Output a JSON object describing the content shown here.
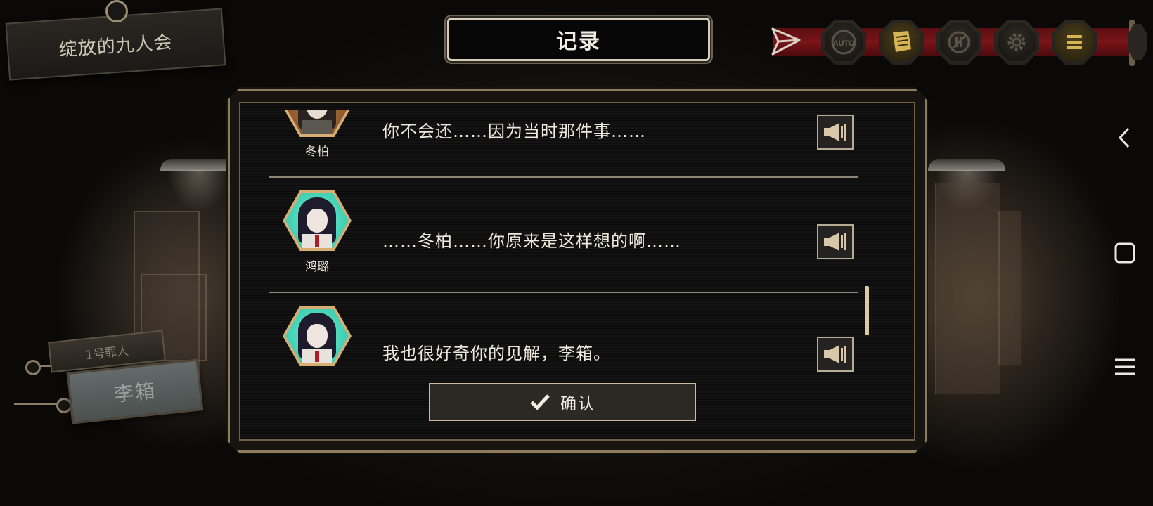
{
  "chapter_title": "绽放的九人会",
  "record_title": "记录",
  "toolbar": {
    "send_icon": "paper-plane-icon",
    "buttons": [
      {
        "name": "auto-button",
        "label": "AUTO"
      },
      {
        "name": "log-button",
        "icon": "document-icon"
      },
      {
        "name": "skip-off-button",
        "icon": "skip-disabled-icon"
      },
      {
        "name": "settings-button",
        "icon": "gear-icon"
      },
      {
        "name": "menu-button",
        "icon": "menu-icon"
      }
    ],
    "accent": "#d6b453",
    "rail_color": "#7a1418"
  },
  "character_tag": {
    "small_label": "1号罪人",
    "name": "李箱"
  },
  "log_entries": [
    {
      "speaker": "冬柏",
      "text": "你不会还……因为当时那件事……",
      "portrait": "brown"
    },
    {
      "speaker": "鸿璐",
      "text": "……冬柏……你原来是这样想的啊……",
      "portrait": "teal"
    },
    {
      "speaker": "",
      "text": "我也很好奇你的见解，李箱。",
      "portrait": "teal"
    }
  ],
  "confirm_label": "确认",
  "system_nav": {
    "back": "back-icon",
    "home": "home-icon",
    "recents": "recents-icon"
  }
}
